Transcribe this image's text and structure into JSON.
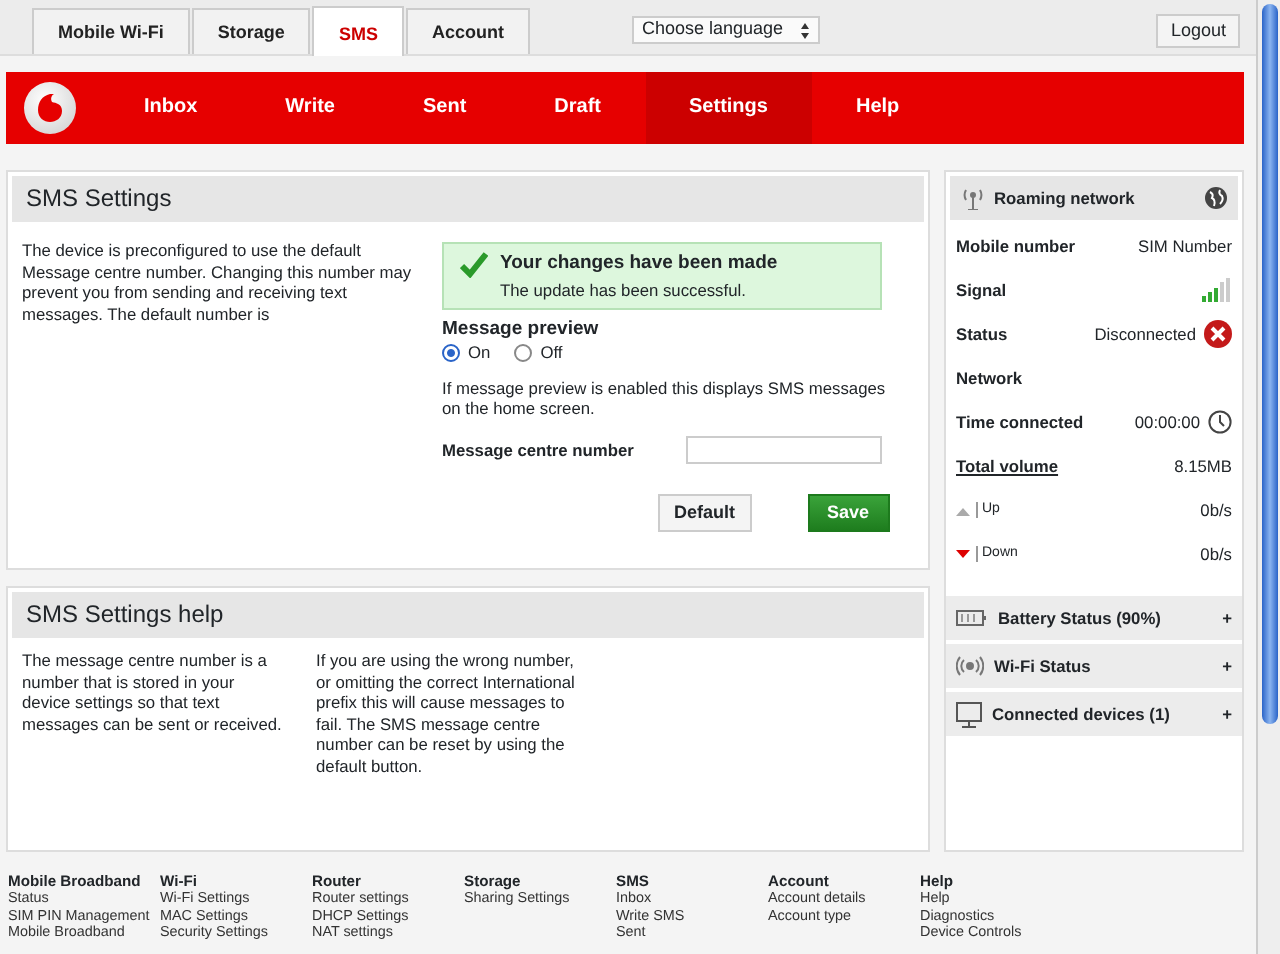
{
  "top_tabs": [
    {
      "label": "Mobile Wi-Fi",
      "selected": false
    },
    {
      "label": "Storage",
      "selected": false
    },
    {
      "label": "SMS",
      "selected": true
    },
    {
      "label": "Account",
      "selected": false
    }
  ],
  "language_select": {
    "value": "Choose language"
  },
  "logout_button": "Logout",
  "nav": [
    {
      "label": "Inbox",
      "selected": false
    },
    {
      "label": "Write",
      "selected": false
    },
    {
      "label": "Sent",
      "selected": false
    },
    {
      "label": "Draft",
      "selected": false
    },
    {
      "label": "Settings",
      "selected": true
    },
    {
      "label": "Help",
      "selected": false
    }
  ],
  "sms_settings": {
    "title": "SMS Settings",
    "description": "The device is preconfigured to use the default Message centre number. Changing this number may prevent you from sending and receiving text messages. The default number is",
    "alert": {
      "title": "Your changes have been made",
      "message": "The update has been successful."
    },
    "preview": {
      "label": "Message preview",
      "options": [
        {
          "label": "On",
          "selected": true
        },
        {
          "label": "Off",
          "selected": false
        }
      ],
      "note": "If message preview is enabled this displays SMS messages on the home screen."
    },
    "centre_number": {
      "label": "Message centre number"
    },
    "buttons": [
      {
        "label": "Default",
        "kind": "secondary"
      },
      {
        "label": "Save",
        "kind": "primary"
      }
    ]
  },
  "help": {
    "title": "SMS Settings help",
    "paragraphs": [
      "The message centre number is a number that is stored in your device settings so that text messages can be sent or received.",
      "If you are using the wrong number, or omitting the correct International prefix this will cause messages to fail. The SMS message centre number can be reset by using the default button."
    ]
  },
  "sidebar": {
    "roaming": {
      "title": "Roaming network",
      "rows": [
        {
          "label": "Mobile number",
          "value": "SIM Number",
          "kind": "text"
        },
        {
          "label": "Signal",
          "kind": "signal"
        },
        {
          "label": "Status",
          "value": "Disconnected",
          "kind": "error"
        },
        {
          "label": "Network",
          "kind": "text"
        },
        {
          "label": "Time connected",
          "value": "00:00:00",
          "kind": "clock"
        },
        {
          "label": "Total volume",
          "value": "8.15MB",
          "kind": "link"
        },
        {
          "label": "Up",
          "value": "0b/s",
          "kind": "up"
        },
        {
          "label": "Down",
          "value": "0b/s",
          "kind": "down"
        }
      ]
    },
    "sections": [
      {
        "title": "Battery Status (90%)",
        "kind": "battery",
        "toggle": "+"
      },
      {
        "title": "Wi-Fi Status",
        "kind": "wifi",
        "toggle": "+"
      },
      {
        "title": "Connected devices (1)",
        "kind": "devices",
        "toggle": "+"
      }
    ]
  },
  "footer": [
    {
      "title": "Mobile Broadband",
      "links": [
        "Status",
        "SIM PIN Management",
        "Mobile Broadband"
      ]
    },
    {
      "title": "Wi-Fi",
      "links": [
        "Wi-Fi Settings",
        "MAC Settings",
        "Security Settings"
      ]
    },
    {
      "title": "Router",
      "links": [
        "Router settings",
        "DHCP Settings",
        "NAT settings"
      ]
    },
    {
      "title": "Storage",
      "links": [
        "Sharing Settings"
      ]
    },
    {
      "title": "SMS",
      "links": [
        "Inbox",
        "Write SMS",
        "Sent"
      ]
    },
    {
      "title": "Account",
      "links": [
        "Account details",
        "Account type"
      ]
    },
    {
      "title": "Help",
      "links": [
        "Help",
        "Diagnostics",
        "Device Controls"
      ]
    }
  ]
}
